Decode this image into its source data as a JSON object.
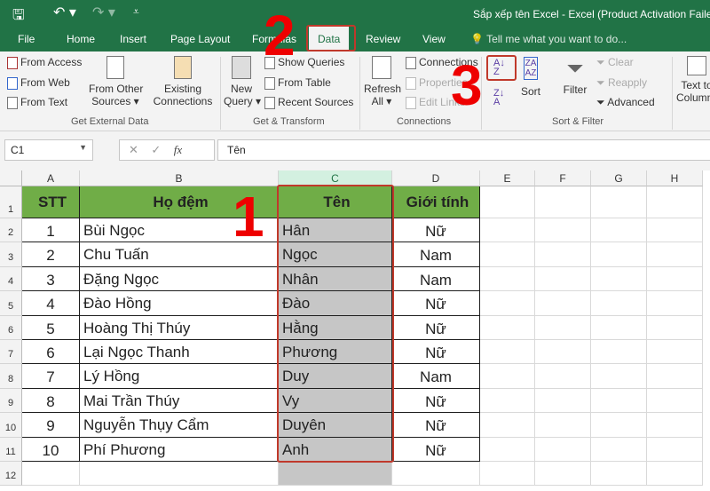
{
  "title": "Sắp xếp tên Excel - Excel (Product Activation Failed)",
  "tabs": [
    "File",
    "Home",
    "Insert",
    "Page Layout",
    "Formulas",
    "Data",
    "Review",
    "View"
  ],
  "tell_me": "Tell me what you want to do...",
  "ribbon": {
    "get_external": {
      "label": "Get External Data",
      "from_access": "From Access",
      "from_web": "From Web",
      "from_text": "From Text",
      "from_other": "From Other",
      "sources": "Sources ▾",
      "existing": "Existing",
      "connections": "Connections"
    },
    "get_transform": {
      "label": "Get & Transform",
      "new": "New",
      "query": "Query ▾",
      "show_queries": "Show Queries",
      "from_table": "From Table",
      "recent_sources": "Recent Sources"
    },
    "connections": {
      "label": "Connections",
      "refresh": "Refresh",
      "all": "All ▾",
      "connections": "Connections",
      "properties": "Properties",
      "edit_links": "Edit Links"
    },
    "sort_filter": {
      "label": "Sort & Filter",
      "sort": "Sort",
      "filter": "Filter",
      "clear": "Clear",
      "reapply": "Reapply",
      "advanced": "Advanced"
    },
    "text_to": "Text to",
    "columns": "Columns"
  },
  "name_box": "C1",
  "formula": "Tên",
  "columns": [
    "A",
    "B",
    "C",
    "D",
    "E",
    "F",
    "G",
    "H"
  ],
  "headers": [
    "STT",
    "Họ đệm",
    "Tên",
    "Giới tính"
  ],
  "rows": [
    [
      "1",
      "Bùi Ngọc",
      "Hân",
      "Nữ"
    ],
    [
      "2",
      "Chu Tuấn",
      "Ngọc",
      "Nam"
    ],
    [
      "3",
      "Đặng Ngọc",
      "Nhân",
      "Nam"
    ],
    [
      "4",
      "Đào Hồng",
      "Đào",
      "Nữ"
    ],
    [
      "5",
      "Hoàng Thị Thúy",
      "Hằng",
      "Nữ"
    ],
    [
      "6",
      "Lại Ngọc Thanh",
      "Phương",
      "Nữ"
    ],
    [
      "7",
      "Lý Hồng",
      "Duy",
      "Nam"
    ],
    [
      "8",
      "Mai Trần Thúy",
      "Vy",
      "Nữ"
    ],
    [
      "9",
      "Nguyễn Thụy Cẩm",
      "Duyên",
      "Nữ"
    ],
    [
      "10",
      "Phí Phương",
      "Anh",
      "Nữ"
    ]
  ],
  "annotations": [
    "1",
    "2",
    "3"
  ],
  "colors": {
    "excel_green": "#217346",
    "header_fill": "#70ad47",
    "selection": "#c6c6c6",
    "annotation": "#e00000"
  }
}
